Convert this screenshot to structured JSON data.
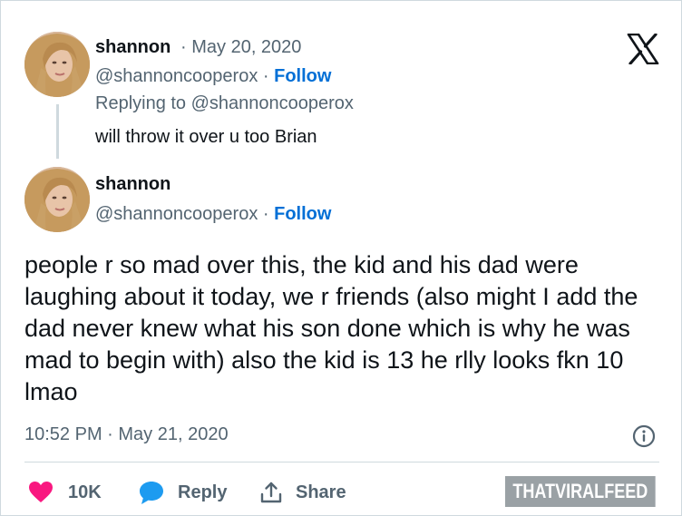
{
  "reply_tweet": {
    "display_name": "shannon",
    "separator": "·",
    "date": "May 20, 2020",
    "handle": "@shannoncooperox",
    "follow_label": "Follow",
    "replying_to": "Replying to @shannoncooperox",
    "text": "will throw it over u too Brian"
  },
  "main_tweet": {
    "display_name": "shannon",
    "handle": "@shannoncooperox",
    "separator": "·",
    "follow_label": "Follow",
    "text": "people r so mad over this, the kid and his dad were laughing about it today,  we r friends (also might I add the dad never knew what his son done which is why he was mad to begin with) also the kid is 13 he rlly looks fkn 10 lmao",
    "timestamp": "10:52 PM · May 21, 2020"
  },
  "actions": {
    "like_count": "10K",
    "reply_label": "Reply",
    "share_label": "Share"
  },
  "watermark": "THATVIRALFEED",
  "icons": {
    "brand": "x-logo-icon",
    "info": "info-icon",
    "like": "heart-icon",
    "reply": "speech-bubble-icon",
    "share": "share-icon"
  },
  "colors": {
    "link": "#006fd6",
    "heart": "#f91880",
    "reply_bubble": "#1d9bf0",
    "muted": "#536471",
    "border": "#cfd9de"
  }
}
